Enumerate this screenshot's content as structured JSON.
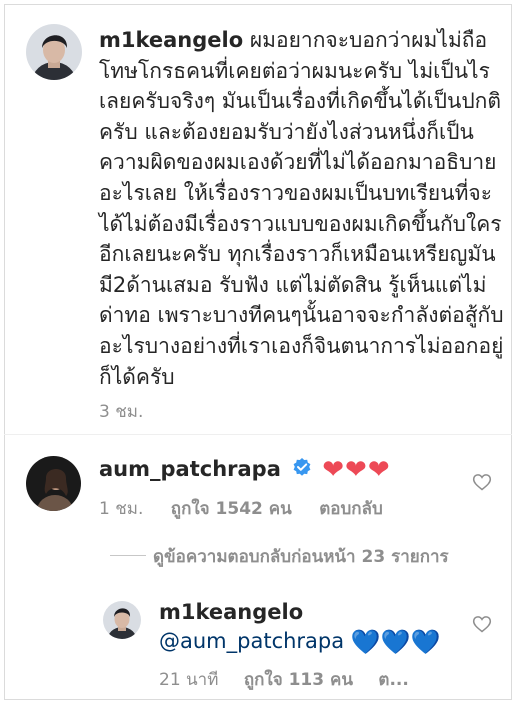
{
  "post": {
    "username": "m1keangelo",
    "caption": "ผมอยากจะบอกว่าผมไม่ถือโทษโกรธคนที่เคยต่อว่าผมนะครับ ไม่เป็นไรเลยครับจริงๆ มันเป็นเรื่องที่เกิดขึ้นได้เป็นปกติครับ และต้องยอมรับว่ายังไงส่วนหนึ่งก็เป็นความผิดของผมเองด้วยที่ไม่ได้ออกมาอธิบายอะไรเลย ให้เรื่องราวของผมเป็นบทเรียนที่จะได้ไม่ต้องมีเรื่องราวแบบของผมเกิดขึ้นกับใครอีกเลยนะครับ ทุกเรื่องราวก็เหมือนเหรียญมันมี2ด้านเสมอ รับฟัง แต่ไม่ตัดสิน รู้เห็นแต่ไม่ด่าทอ เพราะบางทีคนๆนั้นอาจจะกำลังต่อสู้กับอะไรบางอย่างที่เราเองก็จินตนาการไม่ออกอยู่ก็ได้ครับ",
    "time": "3 ชม."
  },
  "comment": {
    "username": "aum_patchrapa",
    "text": "❤❤❤",
    "time": "1 ชม.",
    "likes": "ถูกใจ 1542 คน",
    "reply_label": "ตอบกลับ"
  },
  "view_replies": "ดูข้อความตอบกลับก่อนหน้า 23 รายการ",
  "reply": {
    "username": "m1keangelo",
    "mention": "@aum_patchrapa",
    "text": "💙💙💙",
    "time": "21 นาที",
    "likes": "ถูกใจ 113 คน",
    "reply_label": "ต..."
  },
  "colors": {
    "text": "#262626",
    "muted": "#8e8e8e",
    "verified": "#3897f0",
    "heart_red": "#ed4956",
    "mention": "#003569"
  }
}
